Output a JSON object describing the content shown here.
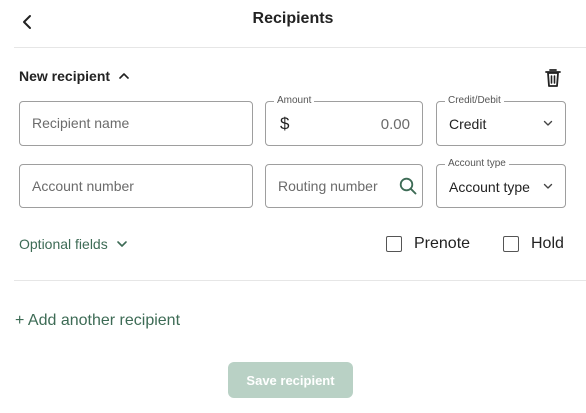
{
  "header": {
    "title": "Recipients",
    "back_icon": "chevron-left-icon"
  },
  "recipient": {
    "section_title": "New recipient",
    "section_toggle_icon": "chevron-up-icon",
    "delete_icon": "trash-icon",
    "name_placeholder": "Recipient name",
    "amount_label": "Amount",
    "amount_currency": "$",
    "amount_value": "0.00",
    "credit_debit_label": "Credit/Debit",
    "credit_debit_value": "Credit",
    "account_number_placeholder": "Account number",
    "routing_number_placeholder": "Routing number",
    "routing_search_icon": "search-icon",
    "account_type_label": "Account type",
    "account_type_value": "Account type",
    "optional_fields_label": "Optional fields",
    "prenote_label": "Prenote",
    "prenote_checked": false,
    "hold_label": "Hold",
    "hold_checked": false
  },
  "actions": {
    "add_another_label": "+ Add another recipient",
    "save_label": "Save recipient"
  },
  "colors": {
    "accent": "#3d6b55",
    "disabled_button": "#b9d1c5"
  }
}
